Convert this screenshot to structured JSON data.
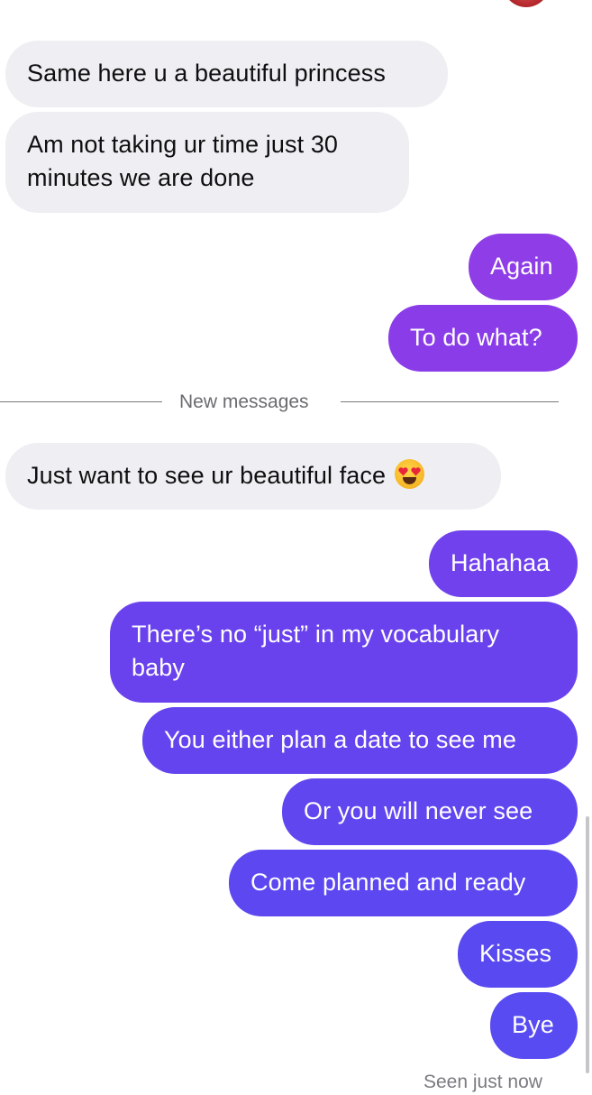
{
  "colors": {
    "incoming_bubble": "#efeff3",
    "outgoing_gradient_top": "#9b3fe6",
    "outgoing_gradient_bottom": "#5a4cf0"
  },
  "messages": [
    {
      "dir": "in",
      "text": "Same here u a beautiful princess"
    },
    {
      "dir": "in",
      "text": "Am not taking ur time just 30 minutes we are done"
    },
    {
      "dir": "out",
      "text": "Again"
    },
    {
      "dir": "out",
      "text": "To do what?"
    },
    {
      "dir": "in",
      "text": "Just want to see ur beautiful face",
      "emoji": "heart-eyes-emoji"
    },
    {
      "dir": "out",
      "text": "Hahahaa"
    },
    {
      "dir": "out",
      "text": "There’s no “just” in my vocabulary baby"
    },
    {
      "dir": "out",
      "text": "You either plan a date to see me"
    },
    {
      "dir": "out",
      "text": "Or you will never see"
    },
    {
      "dir": "out",
      "text": "Come planned and ready"
    },
    {
      "dir": "out",
      "text": "Kisses"
    },
    {
      "dir": "out",
      "text": "Bye"
    }
  ],
  "divider": {
    "label": "New messages"
  },
  "status": {
    "seen_label": "Seen just now"
  }
}
